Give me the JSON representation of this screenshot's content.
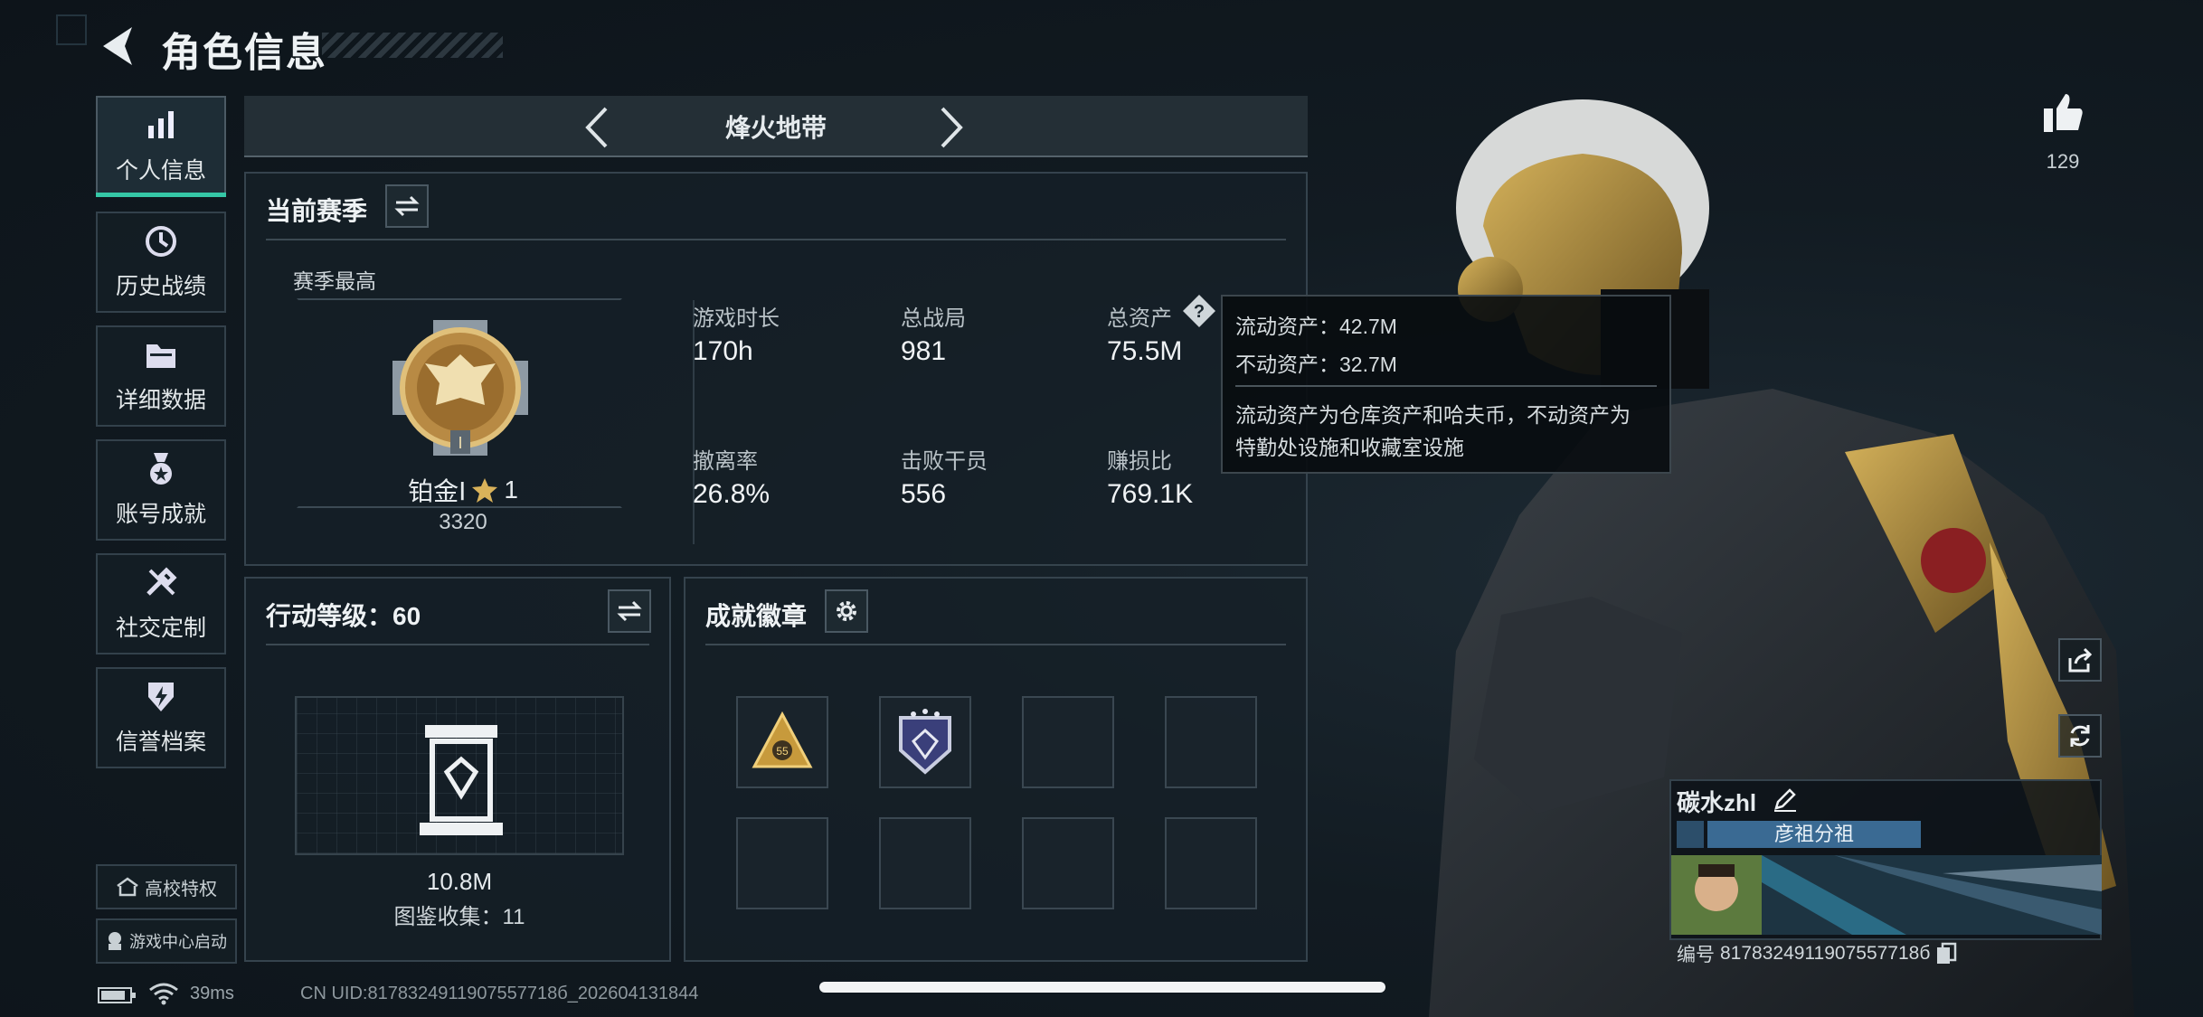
{
  "header": {
    "title": "角色信息"
  },
  "sidebar": {
    "items": [
      {
        "label": "个人信息",
        "icon": "bar-chart-icon",
        "active": true
      },
      {
        "label": "历史战绩",
        "icon": "history-clock-icon",
        "active": false
      },
      {
        "label": "详细数据",
        "icon": "folder-icon",
        "active": false
      },
      {
        "label": "账号成就",
        "icon": "medal-icon",
        "active": false
      },
      {
        "label": "社交定制",
        "icon": "tools-icon",
        "active": false
      },
      {
        "label": "信誉档案",
        "icon": "shield-bolt-icon",
        "active": false
      }
    ],
    "campus_label": "高校特权",
    "game_center_label": "游戏中心启动"
  },
  "map_selector": {
    "name": "烽火地带"
  },
  "season": {
    "title": "当前赛季",
    "best_label": "赛季最高",
    "rank_name": "铂金Ⅰ",
    "rank_stars": "1",
    "rank_points": "3320",
    "stats": [
      {
        "label": "游戏时长",
        "value": "170h"
      },
      {
        "label": "总战局",
        "value": "981"
      },
      {
        "label": "总资产",
        "value": "75.5M"
      },
      {
        "label": "撤离率",
        "value": "26.8%"
      },
      {
        "label": "击败干员",
        "value": "556"
      },
      {
        "label": "赚损比",
        "value": "769.1K"
      }
    ]
  },
  "tooltip": {
    "liquid": "流动资产：42.7M",
    "fixed": "不动资产：32.7M",
    "desc_line1": "流动资产为仓库资产和哈夫币，不动资产为",
    "desc_line2": "特勤处设施和收藏室设施"
  },
  "action_level": {
    "title": "行动等级：60",
    "value": "10.8M",
    "collection": "图鉴收集：11"
  },
  "achievements": {
    "title": "成就徽章",
    "first_badge_number": "55"
  },
  "likes": {
    "count": "129"
  },
  "player": {
    "name": "碳水zhl",
    "tag": "彦祖分祖",
    "id_label": "编号",
    "id_value": "8178324911907557718б"
  },
  "status_bar": {
    "ping": "39ms",
    "uid": "CN UID:8178324911907557718б_202604131844"
  },
  "colors": {
    "accent": "#35c7a6",
    "gold": "#c8a252",
    "panel_border": "#35434d"
  }
}
